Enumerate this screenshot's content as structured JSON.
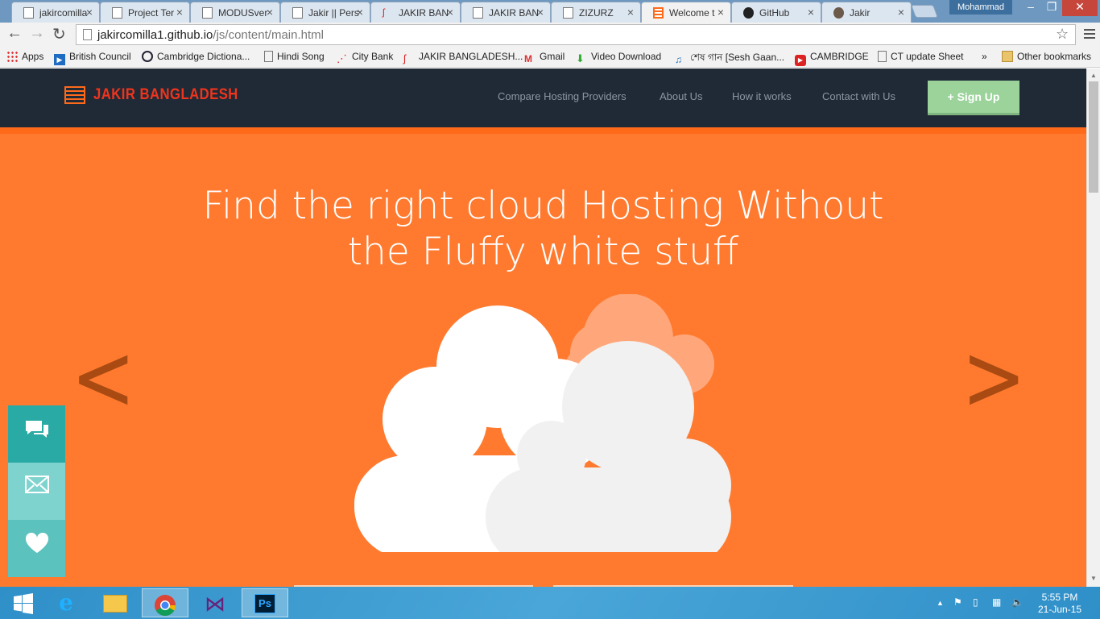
{
  "browser": {
    "tabs": [
      {
        "title": "jakircomilla"
      },
      {
        "title": "Project Ter"
      },
      {
        "title": "MODUSver"
      },
      {
        "title": "Jakir || Pers"
      },
      {
        "title": "JAKIR BAN"
      },
      {
        "title": "JAKIR BAN"
      },
      {
        "title": "ZIZURZ"
      },
      {
        "title": "Welcome t"
      },
      {
        "title": "GitHub"
      },
      {
        "title": "Jakir"
      }
    ],
    "active_tab": 7,
    "user": "Mohammad",
    "url_host": "jakircomilla1.github.io",
    "url_path": "/js/content/main.html",
    "bookmarks": [
      {
        "label": "Apps",
        "icon": "apps-grid-icon"
      },
      {
        "label": "British Council",
        "icon": "play-icon"
      },
      {
        "label": "Cambridge Dictiona...",
        "icon": "cambridge-icon"
      },
      {
        "label": "Hindi Song",
        "icon": "page-icon"
      },
      {
        "label": "City Bank",
        "icon": "citybank-icon"
      },
      {
        "label": "JAKIR BANGLADESH...",
        "icon": "jakir-icon"
      },
      {
        "label": "Gmail",
        "icon": "gmail-icon"
      },
      {
        "label": "Video Download",
        "icon": "download-icon"
      },
      {
        "label": "শেষ গান [Sesh Gaan...",
        "icon": "music-icon"
      },
      {
        "label": "CAMBRIDGE",
        "icon": "youtube-icon"
      },
      {
        "label": "CT update Sheet",
        "icon": "page-icon"
      }
    ],
    "bookmarks_overflow": "»",
    "other_bookmarks": "Other bookmarks"
  },
  "site": {
    "brand": "JAKIR BANGLADESH",
    "nav": [
      {
        "label": "Compare Hosting Providers"
      },
      {
        "label": "About Us"
      },
      {
        "label": "How it works"
      },
      {
        "label": "Contact with Us"
      }
    ],
    "signup": "+ Sign Up",
    "hero_line1": "Find the right cloud Hosting Without",
    "hero_line2": "the Fluffy white stuff",
    "prev_arrow": "<",
    "next_arrow": ">",
    "social": [
      {
        "icon": "chat-icon",
        "color": "#2aaaa4"
      },
      {
        "icon": "mail-icon",
        "color": "#7fd3cf"
      },
      {
        "icon": "heart-icon",
        "color": "#5cc2bd"
      }
    ],
    "colors": {
      "hero": "#ff7a2f",
      "nav": "#202a37",
      "brand": "#f0341c",
      "signup": "#9bd39b"
    }
  },
  "taskbar": {
    "time": "5:55 PM",
    "date": "21-Jun-15"
  }
}
